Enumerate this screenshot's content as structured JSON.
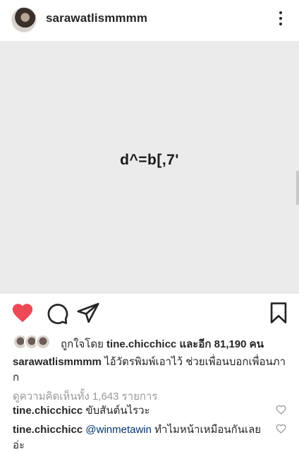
{
  "post": {
    "username": "sarawatlismmmm",
    "image_text": "d^=b[,7'"
  },
  "likes": {
    "prefix": "ถูกใจโดย",
    "user": "tine.chicchicc",
    "and_more": "และอีก 81,190 คน"
  },
  "caption": {
    "username": "sarawatlismmmm",
    "text": "ไอ้วัตรพิมพ์เอาไว้ ช่วยเพื่อนบอกเพื่อนภาก"
  },
  "view_all_comments": "ดูความคิดเห็นทั้ง 1,643 รายการ",
  "comments": [
    {
      "username": "tine.chicchicc",
      "mention": "",
      "text": "ขับสันต์นไรวะ"
    },
    {
      "username": "tine.chicchicc",
      "mention": "@winmetawin",
      "text": "ทำไมหน้าเหมือนกันเลยอ่ะ"
    }
  ],
  "icons": {
    "more": "more-vertical-icon",
    "like": "heart-filled-icon",
    "comment": "comment-bubble-icon",
    "share": "paper-plane-icon",
    "save": "bookmark-icon",
    "comment_like": "heart-outline-icon"
  },
  "colors": {
    "like_red": "#ed4956",
    "mention_blue": "#003569",
    "muted_gray": "#999999"
  }
}
